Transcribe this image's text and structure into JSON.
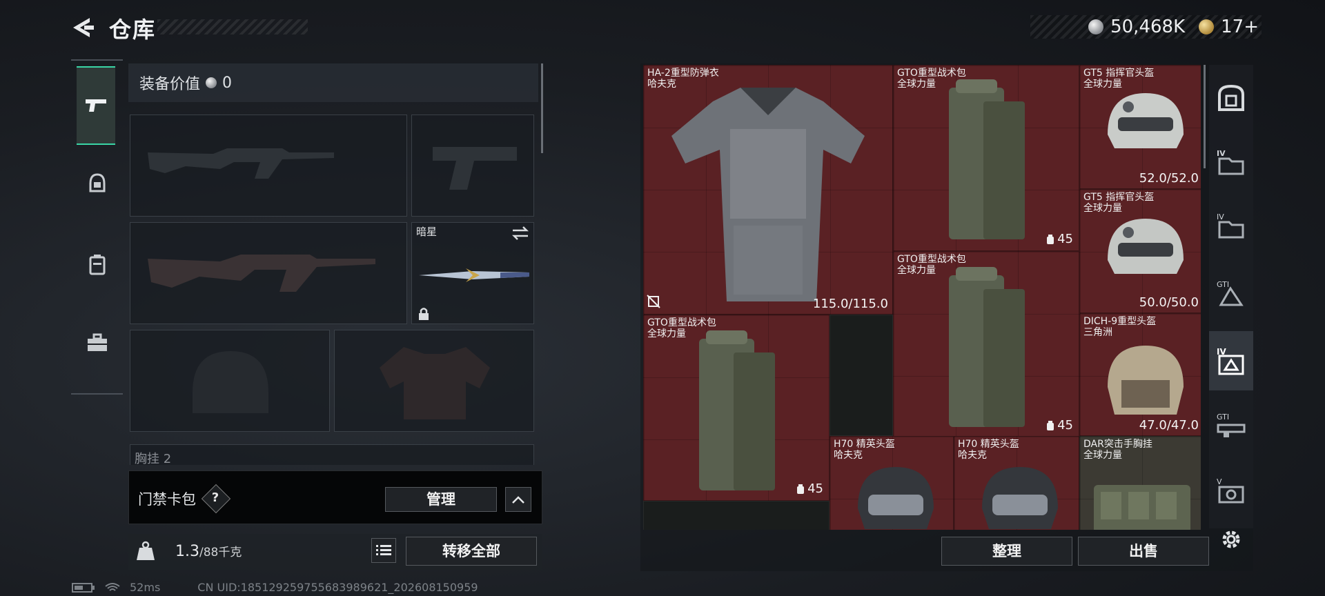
{
  "header": {
    "title": "仓库",
    "silver_amount": "50,468K",
    "gold_amount": "17+"
  },
  "left": {
    "equip_value_label": "装备价值",
    "equip_value": "0",
    "melee_slot_name": "暗星",
    "next_section_label": "胸挂",
    "next_section_count": "2",
    "access_label": "门禁卡包",
    "access_help": "?",
    "manage_label": "管理",
    "weight_current": "1.3",
    "weight_max": "/88千克",
    "transfer_all_label": "转移全部"
  },
  "status": {
    "ping": "52ms",
    "uid": "CN UID:185129259755683989621_202608150959"
  },
  "grid_items": [
    {
      "name": "HA-2重型防弹衣",
      "maker": "哈夫克",
      "value": "115.0/115.0"
    },
    {
      "name": "GTO重型战术包",
      "maker": "全球力量",
      "cap": "45"
    },
    {
      "name": "GT5 指挥官头盔",
      "maker": "全球力量",
      "value": "52.0/52.0"
    },
    {
      "name": "GT5 指挥官头盔",
      "maker": "全球力量",
      "value": "50.0/50.0"
    },
    {
      "name": "GTO重型战术包",
      "maker": "全球力量",
      "cap": "45"
    },
    {
      "name": "GTO重型战术包",
      "maker": "全球力量",
      "cap": "45"
    },
    {
      "name": "DICH-9重型头盔",
      "maker": "三角洲",
      "value": "47.0/47.0"
    },
    {
      "name": "H70 精英头盔",
      "maker": "哈夫克"
    },
    {
      "name": "H70 精英头盔",
      "maker": "哈夫克"
    },
    {
      "name": "DAR突击手胸挂",
      "maker": "全球力量"
    }
  ],
  "right_rail": [
    {
      "icon": "safe-box-icon",
      "level": ""
    },
    {
      "icon": "folder-lv4-icon",
      "level": "IV"
    },
    {
      "icon": "folder-lv4-icon",
      "level": "IV"
    },
    {
      "icon": "armor-lv5-icon",
      "level": "GTI"
    },
    {
      "icon": "armor-lv4-icon",
      "level": "IV"
    },
    {
      "icon": "rifle-lv5-icon",
      "level": "GTI"
    },
    {
      "icon": "camera-lv5-icon",
      "level": "V"
    }
  ],
  "actions": {
    "sort_label": "整理",
    "sell_label": "出售"
  },
  "colors": {
    "accent": "#3ad6a6",
    "cell_red": "#5a2124"
  }
}
